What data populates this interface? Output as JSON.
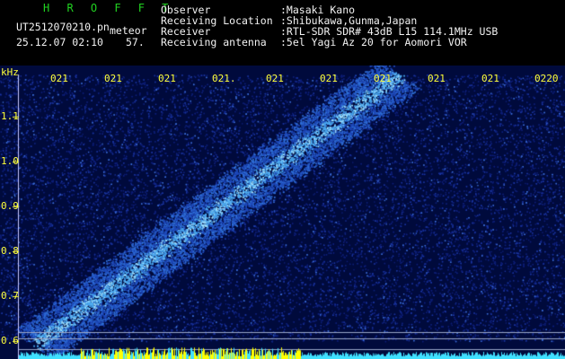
{
  "header": {
    "app_title": "H R O F F T",
    "filename": "UT2512070210.pn",
    "tag": "meteor",
    "datetime": "25.12.07 02:10",
    "count": "57.",
    "labels": {
      "observer": "Observer",
      "location": "Receiving Location",
      "receiver": "Receiver",
      "antenna": "Receiving antenna"
    },
    "values": {
      "observer": ":Masaki Kano",
      "location": ":Shibukawa,Gunma,Japan",
      "receiver": ":RTL-SDR SDR# 43dB L15 114.1MHz USB",
      "antenna": ":5el Yagi Az 20 for Aomori VOR"
    }
  },
  "spectrogram": {
    "unit": "kHz",
    "y_ticks": [
      "1.1",
      "1.0",
      "0.9",
      "0.8",
      "0.7",
      "0.6"
    ],
    "time_ticks": [
      "021",
      "021",
      "021",
      "021.",
      "021",
      "021",
      "021",
      "021",
      "021",
      "0220"
    ],
    "colors": {
      "background": "#000a3c",
      "noise": "#1e3cb4",
      "trail": "#50b4ff",
      "baseline": "#40e0ff",
      "burst": "#ffff00",
      "axis": "#ffff3a"
    }
  }
}
